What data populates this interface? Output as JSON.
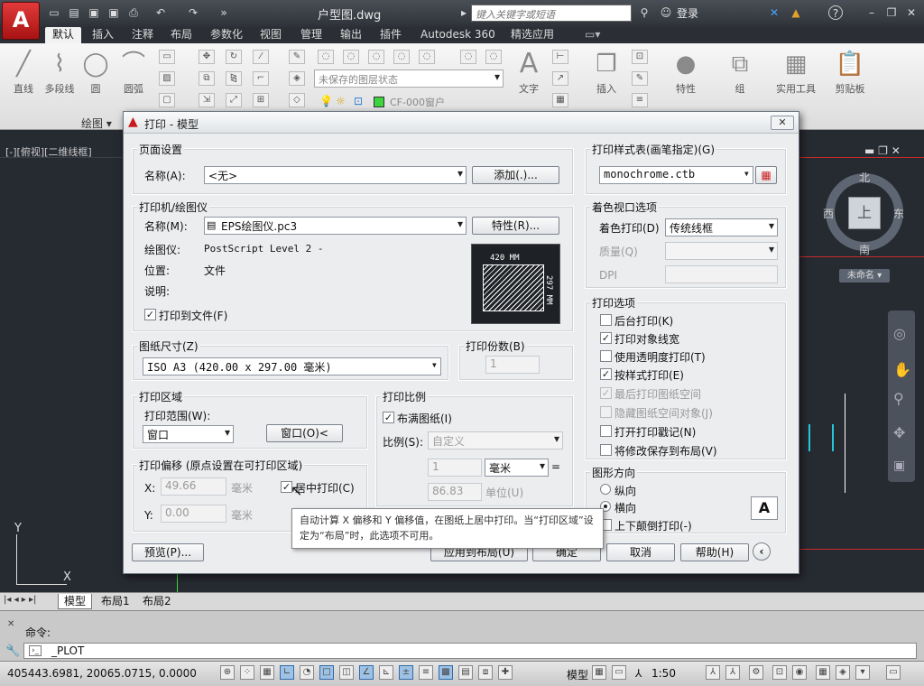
{
  "app": {
    "logo": "A",
    "doc_title": "户型图.dwg",
    "search_placeholder": "键入关键字或短语",
    "login": "登录",
    "help": "?"
  },
  "ribbon": {
    "tabs": [
      "默认",
      "插入",
      "注释",
      "布局",
      "参数化",
      "视图",
      "管理",
      "输出",
      "插件",
      "Autodesk 360",
      "精选应用"
    ],
    "active_tab": "默认",
    "draw_tools": [
      "直线",
      "多段线",
      "圆",
      "圆弧"
    ],
    "layer_state": "未保存的图层状态",
    "layer_current": "CF-000窗户",
    "big_tools": [
      "文字",
      "插入",
      "特性",
      "组",
      "实用工具",
      "剪贴板"
    ],
    "panel_label": "绘图 ▾"
  },
  "viewport": {
    "label": "[-][俯视][二维线框]",
    "compass": {
      "n": "北",
      "s": "南",
      "w": "西",
      "e": "东",
      "top": "上"
    },
    "wcs": "未命名 ▾",
    "axis_y": "Y",
    "axis_x": "X"
  },
  "dialog": {
    "title": "打印 - 模型",
    "page_setup": {
      "group": "页面设置",
      "name_label": "名称(A):",
      "name_value": "<无>",
      "add_btn": "添加(.)..."
    },
    "printer": {
      "group": "打印机/绘图仪",
      "name_label": "名称(M):",
      "name_value": "EPS绘图仪.pc3",
      "props_btn": "特性(R)...",
      "plotter_label": "绘图仪:",
      "plotter_value": "PostScript Level 2 -",
      "where_label": "位置:",
      "where_value": "文件",
      "desc_label": "说明:",
      "to_file": "打印到文件(F)",
      "to_file_checked": true,
      "paper_w": "420 MM",
      "paper_h": "297 MM"
    },
    "paper_size": {
      "group": "图纸尺寸(Z)",
      "value": "ISO A3 (420.00 x 297.00 毫米)"
    },
    "copies": {
      "group": "打印份数(B)",
      "value": "1"
    },
    "area": {
      "group": "打印区域",
      "what_label": "打印范围(W):",
      "what_value": "窗口",
      "window_btn": "窗口(O)<"
    },
    "offset": {
      "group": "打印偏移 (原点设置在可打印区域)",
      "x_label": "X:",
      "x_value": "49.66",
      "x_unit": "毫米",
      "y_label": "Y:",
      "y_value": "0.00",
      "y_unit": "毫米",
      "center": "居中打印(C)",
      "center_checked": true
    },
    "scale": {
      "group": "打印比例",
      "fit": "布满图纸(I)",
      "fit_checked": true,
      "scale_label": "比例(S):",
      "scale_value": "自定义",
      "num_value": "1",
      "unit_value": "毫米",
      "equals": "=",
      "den_value": "86.83",
      "den_unit": "单位(U)"
    },
    "style_table": {
      "group": "打印样式表(画笔指定)(G)",
      "value": "monochrome.ctb"
    },
    "shaded": {
      "group": "着色视口选项",
      "shade_label": "着色打印(D)",
      "shade_value": "传统线框",
      "quality_label": "质量(Q)",
      "dpi_label": "DPI"
    },
    "options": {
      "group": "打印选项",
      "items": [
        {
          "label": "后台打印(K)",
          "checked": false,
          "disabled": false
        },
        {
          "label": "打印对象线宽",
          "checked": true,
          "disabled": false
        },
        {
          "label": "使用透明度打印(T)",
          "checked": false,
          "disabled": false
        },
        {
          "label": "按样式打印(E)",
          "checked": true,
          "disabled": false
        },
        {
          "label": "最后打印图纸空间",
          "checked": true,
          "disabled": true
        },
        {
          "label": "隐藏图纸空间对象(J)",
          "checked": false,
          "disabled": true
        },
        {
          "label": "打开打印戳记(N)",
          "checked": false,
          "disabled": false
        },
        {
          "label": "将修改保存到布局(V)",
          "checked": false,
          "disabled": false
        }
      ]
    },
    "orientation": {
      "group": "图形方向",
      "portrait": "纵向",
      "landscape": "横向",
      "upside": "上下颠倒打印(-)",
      "icon": "A"
    },
    "tooltip": "自动计算 X 偏移和 Y 偏移值，在图纸上居中打印。当“打印区域”设定为“布局”时，此选项不可用。",
    "buttons": {
      "preview": "预览(P)...",
      "apply": "应用到布局(U)",
      "ok": "确定",
      "cancel": "取消",
      "help": "帮助(H)",
      "more": "‹"
    }
  },
  "layout_tabs": [
    "模型",
    "布局1",
    "布局2"
  ],
  "command": {
    "label": "命令:",
    "input": "_PLOT"
  },
  "status": {
    "coords": "405443.6981, 20065.0715, 0.0000",
    "model": "模型",
    "scale": "1:50"
  }
}
